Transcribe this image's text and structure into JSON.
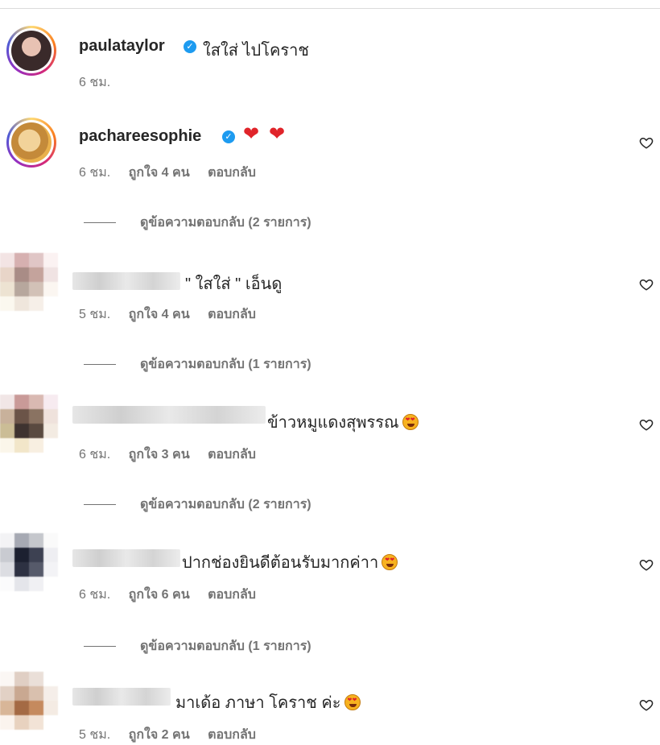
{
  "comments": [
    {
      "username": "paulataylor",
      "verified": true,
      "text": "ใสใส่ ไปโคราช",
      "time": "6 ชม.",
      "likes": "",
      "reply": "",
      "replies_link": ""
    },
    {
      "username": "pachareesophie",
      "verified": true,
      "text": "",
      "emojis": [
        "red-heart",
        "red-heart"
      ],
      "time": "6 ชม.",
      "likes": "ถูกใจ 4 คน",
      "reply": "ตอบกลับ",
      "replies_link": "ดูข้อความตอบกลับ (2 รายการ)"
    },
    {
      "username": "",
      "verified": false,
      "text": "\" ใสใส่ \" เอ็นดู",
      "time": "5 ชม.",
      "likes": "ถูกใจ 4 คน",
      "reply": "ตอบกลับ",
      "replies_link": "ดูข้อความตอบกลับ (1 รายการ)"
    },
    {
      "username": "",
      "verified": false,
      "text": "ข้าวหมูแดงสุพรรณ",
      "time": "6 ชม.",
      "likes": "ถูกใจ 3 คน",
      "reply": "ตอบกลับ",
      "replies_link": "ดูข้อความตอบกลับ (2 รายการ)"
    },
    {
      "username": "",
      "verified": false,
      "text": "ปากช่องยินดีต้อนรับมากค่าา",
      "time": "6 ชม.",
      "likes": "ถูกใจ 6 คน",
      "reply": "ตอบกลับ",
      "replies_link": "ดูข้อความตอบกลับ (1 รายการ)"
    },
    {
      "username": "",
      "verified": false,
      "text": "มาเด้อ ภาษา โคราช ค่ะ",
      "time": "5 ชม.",
      "likes": "ถูกใจ 2 คน",
      "reply": "ตอบกลับ",
      "replies_link": ""
    }
  ],
  "icons": {
    "like": "heart-outline-icon",
    "verified": "verified-badge-icon",
    "emoji": "heart-eyes-emoji-icon"
  },
  "colors": {
    "verified_blue": "#1d9bf0",
    "meta_gray": "#737373",
    "text": "#262626",
    "heart_red": "#e0242a"
  }
}
